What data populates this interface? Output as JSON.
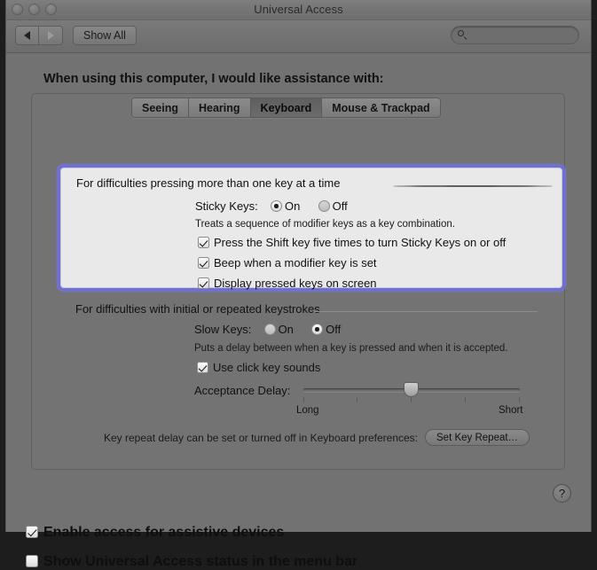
{
  "window": {
    "title": "Universal Access",
    "traffic_lights": [
      "close",
      "minimize",
      "zoom"
    ]
  },
  "toolbar": {
    "back_icon": "triangle-left-icon",
    "forward_icon": "triangle-right-icon",
    "show_all_label": "Show All",
    "search": {
      "value": "",
      "placeholder": "",
      "icon": "search-icon"
    }
  },
  "content": {
    "headline": "When using this computer, I would like assistance with:",
    "tabs": [
      {
        "label": "Seeing",
        "selected": false
      },
      {
        "label": "Hearing",
        "selected": false
      },
      {
        "label": "Keyboard",
        "selected": true
      },
      {
        "label": "Mouse & Trackpad",
        "selected": false
      }
    ],
    "sticky_section": {
      "title": "For difficulties pressing more than one key at a time",
      "sticky_keys_label": "Sticky Keys:",
      "on_label": "On",
      "off_label": "Off",
      "selected": "On",
      "description": "Treats a sequence of modifier keys as a key combination.",
      "checkboxes": [
        {
          "label": "Press the Shift key five times to turn Sticky Keys on or off",
          "checked": true
        },
        {
          "label": "Beep when a modifier key is set",
          "checked": true
        },
        {
          "label": "Display pressed keys on screen",
          "checked": true
        }
      ]
    },
    "slow_section": {
      "title": "For difficulties with initial or repeated keystrokes",
      "slow_keys_label": "Slow Keys:",
      "on_label": "On",
      "off_label": "Off",
      "selected": "Off",
      "description": "Puts a delay between when a key is pressed and when it is accepted.",
      "checkbox": {
        "label": "Use click key sounds",
        "checked": true
      },
      "slider": {
        "label": "Acceptance Delay:",
        "min_label": "Long",
        "max_label": "Short",
        "ticks": 5,
        "value_index": 3
      },
      "key_repeat_note": "Key repeat delay can be set or turned off in Keyboard preferences:",
      "key_repeat_button": "Set Key Repeat…"
    },
    "help_button": "?",
    "bottom_checkboxes": [
      {
        "label": "Enable access for assistive devices",
        "checked": true
      },
      {
        "label": "Show Universal Access status in the menu bar",
        "checked": false
      }
    ]
  }
}
